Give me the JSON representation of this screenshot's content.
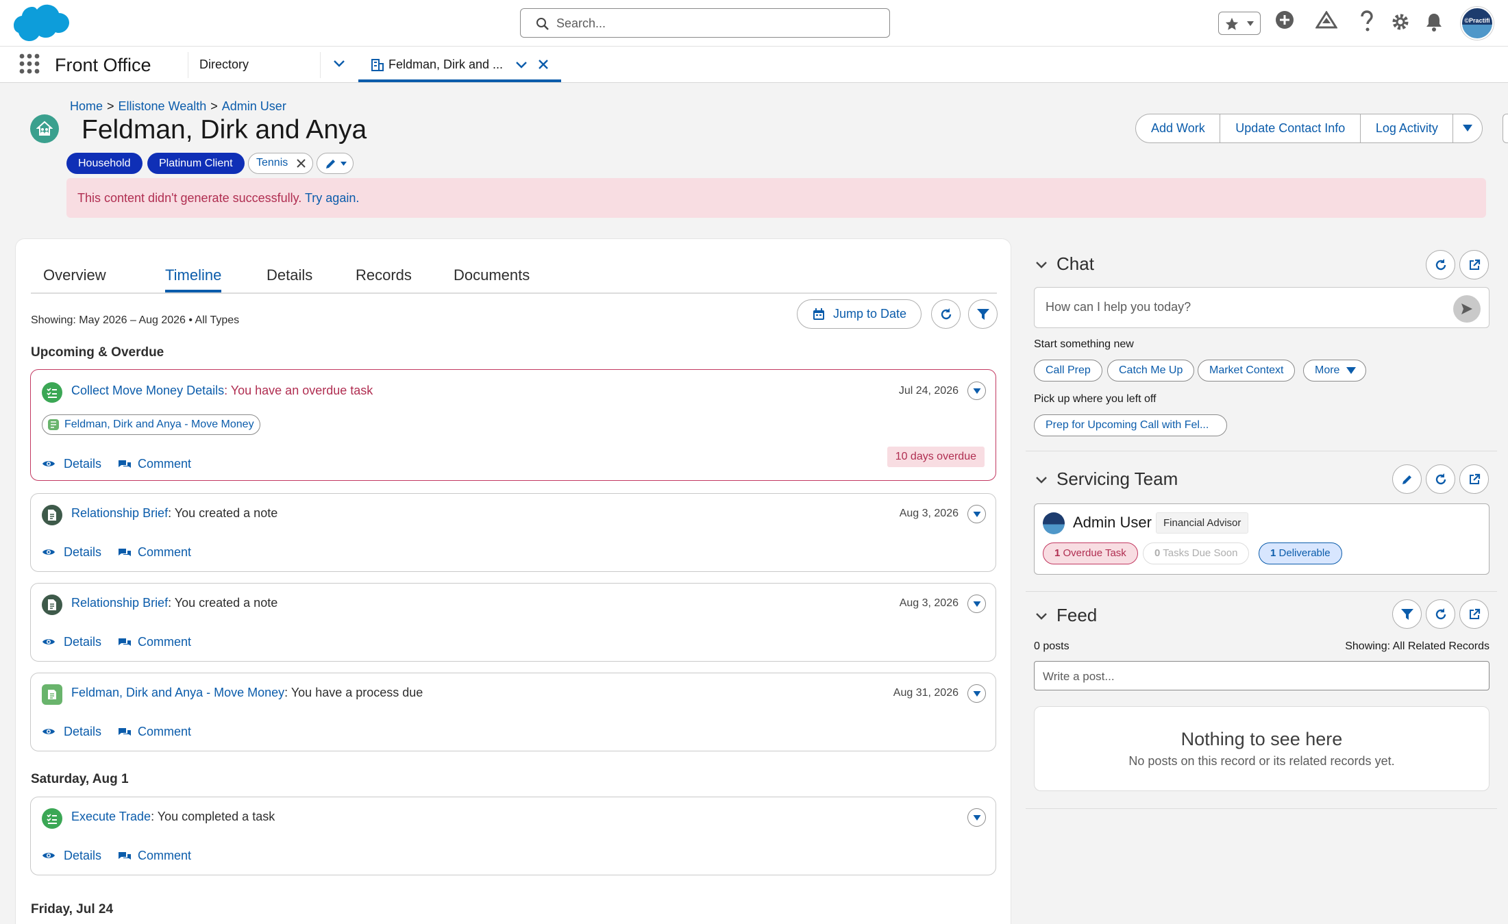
{
  "header": {
    "search_placeholder": "Search..."
  },
  "nav": {
    "app_name": "Front Office",
    "directory_label": "Directory",
    "active_tab_label": "Feldman, Dirk and ..."
  },
  "breadcrumb": {
    "home": "Home",
    "sep1": ">",
    "account": "Ellistone Wealth",
    "sep2": ">",
    "user": "Admin User"
  },
  "record": {
    "title": "Feldman, Dirk and Anya",
    "badges": [
      "Household",
      "Platinum Client"
    ],
    "tag": "Tennis",
    "actions": [
      "Add Work",
      "Update Contact Info",
      "Log Activity"
    ],
    "error_text": "This content didn't generate successfully.",
    "error_link": "Try again."
  },
  "tabs": [
    "Overview",
    "Timeline",
    "Details",
    "Records",
    "Documents"
  ],
  "timeline": {
    "showing": "Showing: May 2026 – Aug 2026 • All Types",
    "jump_label": "Jump to Date",
    "sections": [
      "Upcoming & Overdue",
      "Saturday, Aug 1",
      "Friday, Jul 24"
    ],
    "details_label": "Details",
    "comment_label": "Comment",
    "items": [
      {
        "link": "Collect Move Money Details",
        "text": ": You have an overdue task",
        "date": "Jul 24, 2026",
        "related": "Feldman, Dirk and Anya - Move Money",
        "overdue": "10 days overdue"
      },
      {
        "link": "Relationship Brief",
        "text": ": You created a note",
        "date": "Aug 3, 2026"
      },
      {
        "link": "Relationship Brief",
        "text": ": You created a note",
        "date": "Aug 3, 2026"
      },
      {
        "link": "Feldman, Dirk and Anya - Move Money",
        "text": ": You have a process due",
        "date": "Aug 31, 2026"
      },
      {
        "link": "Execute Trade",
        "text": ": You completed a task",
        "date": ""
      }
    ]
  },
  "chat": {
    "title": "Chat",
    "placeholder": "How can I help you today?",
    "start_label": "Start something new",
    "chips": [
      "Call Prep",
      "Catch Me Up",
      "Market Context",
      "More"
    ],
    "resume_label": "Pick up where you left off",
    "resume_item": "Prep for Upcoming Call with Fel..."
  },
  "team": {
    "title": "Servicing Team",
    "member_name": "Admin User",
    "member_role": "Financial Advisor",
    "overdue_count": "1",
    "overdue_label": "Overdue Task",
    "due_soon_count": "0",
    "due_soon_label": "Tasks Due Soon",
    "deliverable_count": "1",
    "deliverable_label": "Deliverable"
  },
  "feed": {
    "title": "Feed",
    "posts": "0 posts",
    "showing": "Showing: All Related Records",
    "placeholder": "Write a post...",
    "empty_title": "Nothing to see here",
    "empty_sub": "No posts on this record or its related records yet."
  },
  "colors": {
    "brand_blue": "#0b5cab",
    "badge_blue": "#0f2fb6",
    "overdue_red": "#b02e51",
    "task_green": "#3ba755",
    "note_dark": "#3e5a4a"
  },
  "avatar_text": "©Practifi"
}
